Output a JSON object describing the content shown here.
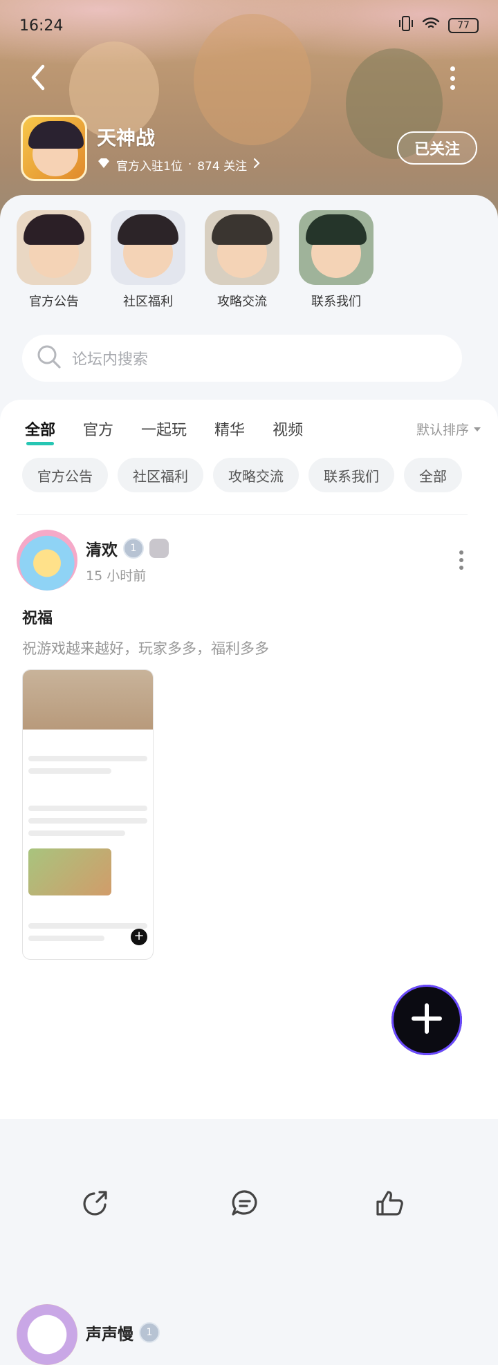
{
  "status_bar": {
    "time": "16:24",
    "battery": "77"
  },
  "forum": {
    "name": "天神战",
    "official_count": "官方入驻1位",
    "separator": "·",
    "followers": "874 关注",
    "follow_label": "已关注"
  },
  "quick_links": [
    {
      "label": "官方公告",
      "hair": "#2b1f26",
      "bg": "#e9d7c3"
    },
    {
      "label": "社区福利",
      "hair": "#2c2428",
      "bg": "#e3e6ee"
    },
    {
      "label": "攻略交流",
      "hair": "#3a3530",
      "bg": "#d8cfc0"
    },
    {
      "label": "联系我们",
      "hair": "#25352a",
      "bg": "#9fb39a"
    }
  ],
  "search": {
    "placeholder": "论坛内搜索"
  },
  "tabs": [
    {
      "label": "全部",
      "active": true
    },
    {
      "label": "官方"
    },
    {
      "label": "一起玩"
    },
    {
      "label": "精华"
    },
    {
      "label": "视频"
    }
  ],
  "sort_label": "默认排序",
  "chips": [
    "官方公告",
    "社区福利",
    "攻略交流",
    "联系我们",
    "全部"
  ],
  "post": {
    "author": "清欢",
    "level": "1",
    "time": "15 小时前",
    "title": "祝福",
    "body": "祝游戏越来越好，玩家多多，福利多多"
  },
  "post2": {
    "author": "声声慢",
    "level": "1"
  },
  "colors": {
    "accent": "#26c6b3",
    "fab_ring": "#6b4aff"
  }
}
